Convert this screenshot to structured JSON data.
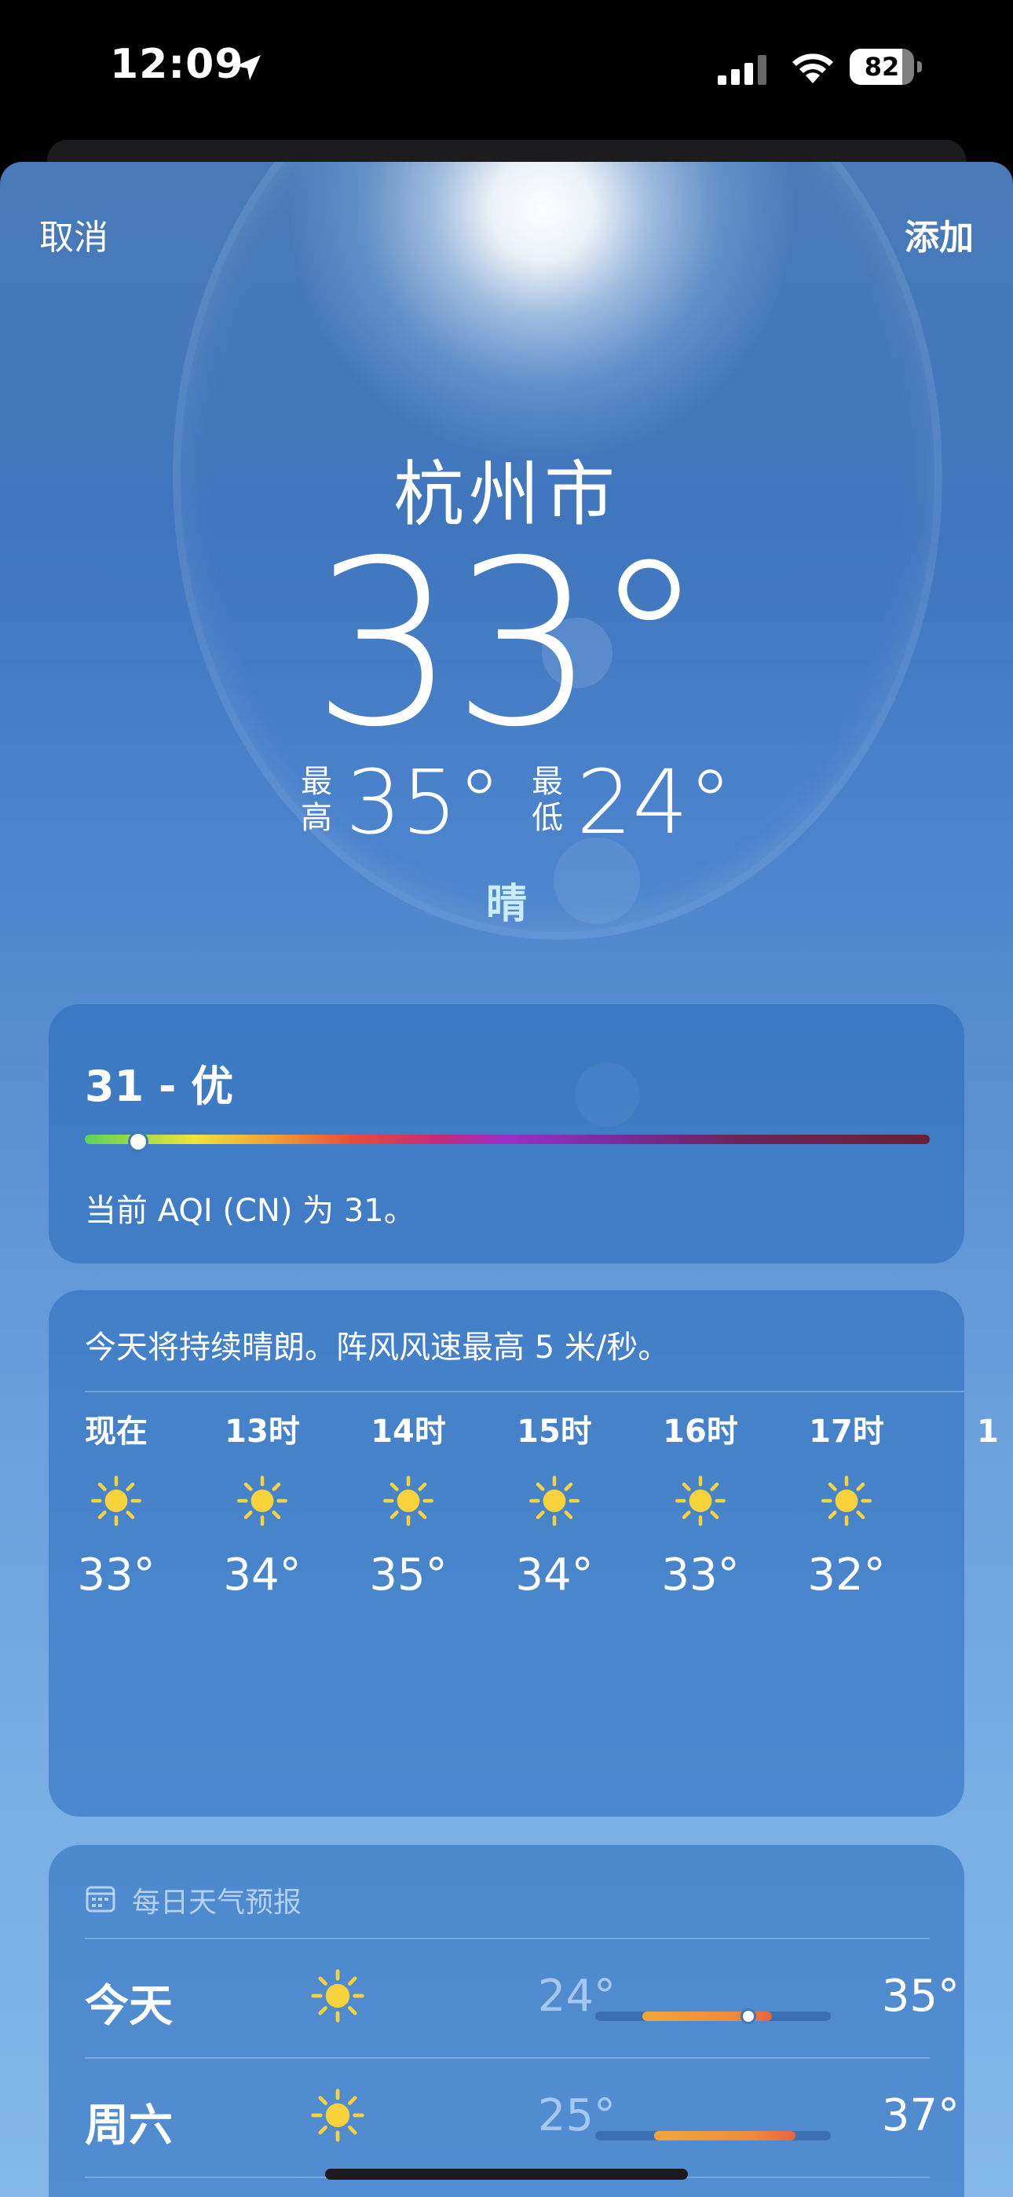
{
  "status_bar": {
    "time": "12:09",
    "battery": "82",
    "battery_level": 0.82
  },
  "nav": {
    "cancel": "取消",
    "add": "添加"
  },
  "location": {
    "city": "杭州市",
    "temperature": "33°",
    "high_label_1": "最",
    "high_label_2": "高",
    "high": "35°",
    "low_label_1": "最",
    "low_label_2": "低",
    "low": "24°",
    "condition": "晴"
  },
  "aqi": {
    "value": "31 - 优",
    "description": "当前 AQI (CN) 为 31。",
    "level": 31
  },
  "hourly": {
    "summary": "今天将持续晴朗。阵风风速最高 5 米/秒。",
    "items": [
      {
        "label": "现在",
        "icon": "sun-icon",
        "temp": "33°"
      },
      {
        "label": "13时",
        "icon": "sun-icon",
        "temp": "34°"
      },
      {
        "label": "14时",
        "icon": "sun-icon",
        "temp": "35°"
      },
      {
        "label": "15时",
        "icon": "sun-icon",
        "temp": "34°"
      },
      {
        "label": "16时",
        "icon": "sun-icon",
        "temp": "33°"
      },
      {
        "label": "17时",
        "icon": "sun-icon",
        "temp": "32°"
      },
      {
        "label": "1",
        "icon": "sun-icon",
        "temp": ""
      }
    ]
  },
  "daily": {
    "header": "每日天气预报",
    "days": [
      {
        "name": "今天",
        "icon": "sun-icon",
        "low": "24°",
        "high": "35°",
        "current": "33°"
      },
      {
        "name": "周六",
        "icon": "sun-icon",
        "low": "25°",
        "high": "37°"
      }
    ]
  },
  "colors": {
    "sun": "#f7d23b",
    "condition_text": "#c9ecff"
  }
}
